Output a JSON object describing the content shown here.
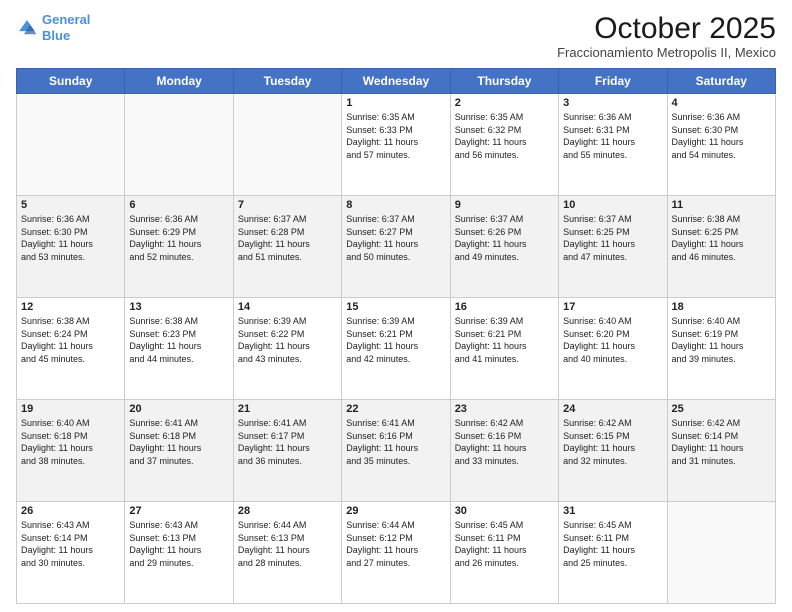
{
  "logo": {
    "line1": "General",
    "line2": "Blue"
  },
  "title": "October 2025",
  "subtitle": "Fraccionamiento Metropolis II, Mexico",
  "days_of_week": [
    "Sunday",
    "Monday",
    "Tuesday",
    "Wednesday",
    "Thursday",
    "Friday",
    "Saturday"
  ],
  "weeks": [
    [
      {
        "day": "",
        "info": ""
      },
      {
        "day": "",
        "info": ""
      },
      {
        "day": "",
        "info": ""
      },
      {
        "day": "1",
        "info": "Sunrise: 6:35 AM\nSunset: 6:33 PM\nDaylight: 11 hours\nand 57 minutes."
      },
      {
        "day": "2",
        "info": "Sunrise: 6:35 AM\nSunset: 6:32 PM\nDaylight: 11 hours\nand 56 minutes."
      },
      {
        "day": "3",
        "info": "Sunrise: 6:36 AM\nSunset: 6:31 PM\nDaylight: 11 hours\nand 55 minutes."
      },
      {
        "day": "4",
        "info": "Sunrise: 6:36 AM\nSunset: 6:30 PM\nDaylight: 11 hours\nand 54 minutes."
      }
    ],
    [
      {
        "day": "5",
        "info": "Sunrise: 6:36 AM\nSunset: 6:30 PM\nDaylight: 11 hours\nand 53 minutes."
      },
      {
        "day": "6",
        "info": "Sunrise: 6:36 AM\nSunset: 6:29 PM\nDaylight: 11 hours\nand 52 minutes."
      },
      {
        "day": "7",
        "info": "Sunrise: 6:37 AM\nSunset: 6:28 PM\nDaylight: 11 hours\nand 51 minutes."
      },
      {
        "day": "8",
        "info": "Sunrise: 6:37 AM\nSunset: 6:27 PM\nDaylight: 11 hours\nand 50 minutes."
      },
      {
        "day": "9",
        "info": "Sunrise: 6:37 AM\nSunset: 6:26 PM\nDaylight: 11 hours\nand 49 minutes."
      },
      {
        "day": "10",
        "info": "Sunrise: 6:37 AM\nSunset: 6:25 PM\nDaylight: 11 hours\nand 47 minutes."
      },
      {
        "day": "11",
        "info": "Sunrise: 6:38 AM\nSunset: 6:25 PM\nDaylight: 11 hours\nand 46 minutes."
      }
    ],
    [
      {
        "day": "12",
        "info": "Sunrise: 6:38 AM\nSunset: 6:24 PM\nDaylight: 11 hours\nand 45 minutes."
      },
      {
        "day": "13",
        "info": "Sunrise: 6:38 AM\nSunset: 6:23 PM\nDaylight: 11 hours\nand 44 minutes."
      },
      {
        "day": "14",
        "info": "Sunrise: 6:39 AM\nSunset: 6:22 PM\nDaylight: 11 hours\nand 43 minutes."
      },
      {
        "day": "15",
        "info": "Sunrise: 6:39 AM\nSunset: 6:21 PM\nDaylight: 11 hours\nand 42 minutes."
      },
      {
        "day": "16",
        "info": "Sunrise: 6:39 AM\nSunset: 6:21 PM\nDaylight: 11 hours\nand 41 minutes."
      },
      {
        "day": "17",
        "info": "Sunrise: 6:40 AM\nSunset: 6:20 PM\nDaylight: 11 hours\nand 40 minutes."
      },
      {
        "day": "18",
        "info": "Sunrise: 6:40 AM\nSunset: 6:19 PM\nDaylight: 11 hours\nand 39 minutes."
      }
    ],
    [
      {
        "day": "19",
        "info": "Sunrise: 6:40 AM\nSunset: 6:18 PM\nDaylight: 11 hours\nand 38 minutes."
      },
      {
        "day": "20",
        "info": "Sunrise: 6:41 AM\nSunset: 6:18 PM\nDaylight: 11 hours\nand 37 minutes."
      },
      {
        "day": "21",
        "info": "Sunrise: 6:41 AM\nSunset: 6:17 PM\nDaylight: 11 hours\nand 36 minutes."
      },
      {
        "day": "22",
        "info": "Sunrise: 6:41 AM\nSunset: 6:16 PM\nDaylight: 11 hours\nand 35 minutes."
      },
      {
        "day": "23",
        "info": "Sunrise: 6:42 AM\nSunset: 6:16 PM\nDaylight: 11 hours\nand 33 minutes."
      },
      {
        "day": "24",
        "info": "Sunrise: 6:42 AM\nSunset: 6:15 PM\nDaylight: 11 hours\nand 32 minutes."
      },
      {
        "day": "25",
        "info": "Sunrise: 6:42 AM\nSunset: 6:14 PM\nDaylight: 11 hours\nand 31 minutes."
      }
    ],
    [
      {
        "day": "26",
        "info": "Sunrise: 6:43 AM\nSunset: 6:14 PM\nDaylight: 11 hours\nand 30 minutes."
      },
      {
        "day": "27",
        "info": "Sunrise: 6:43 AM\nSunset: 6:13 PM\nDaylight: 11 hours\nand 29 minutes."
      },
      {
        "day": "28",
        "info": "Sunrise: 6:44 AM\nSunset: 6:13 PM\nDaylight: 11 hours\nand 28 minutes."
      },
      {
        "day": "29",
        "info": "Sunrise: 6:44 AM\nSunset: 6:12 PM\nDaylight: 11 hours\nand 27 minutes."
      },
      {
        "day": "30",
        "info": "Sunrise: 6:45 AM\nSunset: 6:11 PM\nDaylight: 11 hours\nand 26 minutes."
      },
      {
        "day": "31",
        "info": "Sunrise: 6:45 AM\nSunset: 6:11 PM\nDaylight: 11 hours\nand 25 minutes."
      },
      {
        "day": "",
        "info": ""
      }
    ]
  ]
}
